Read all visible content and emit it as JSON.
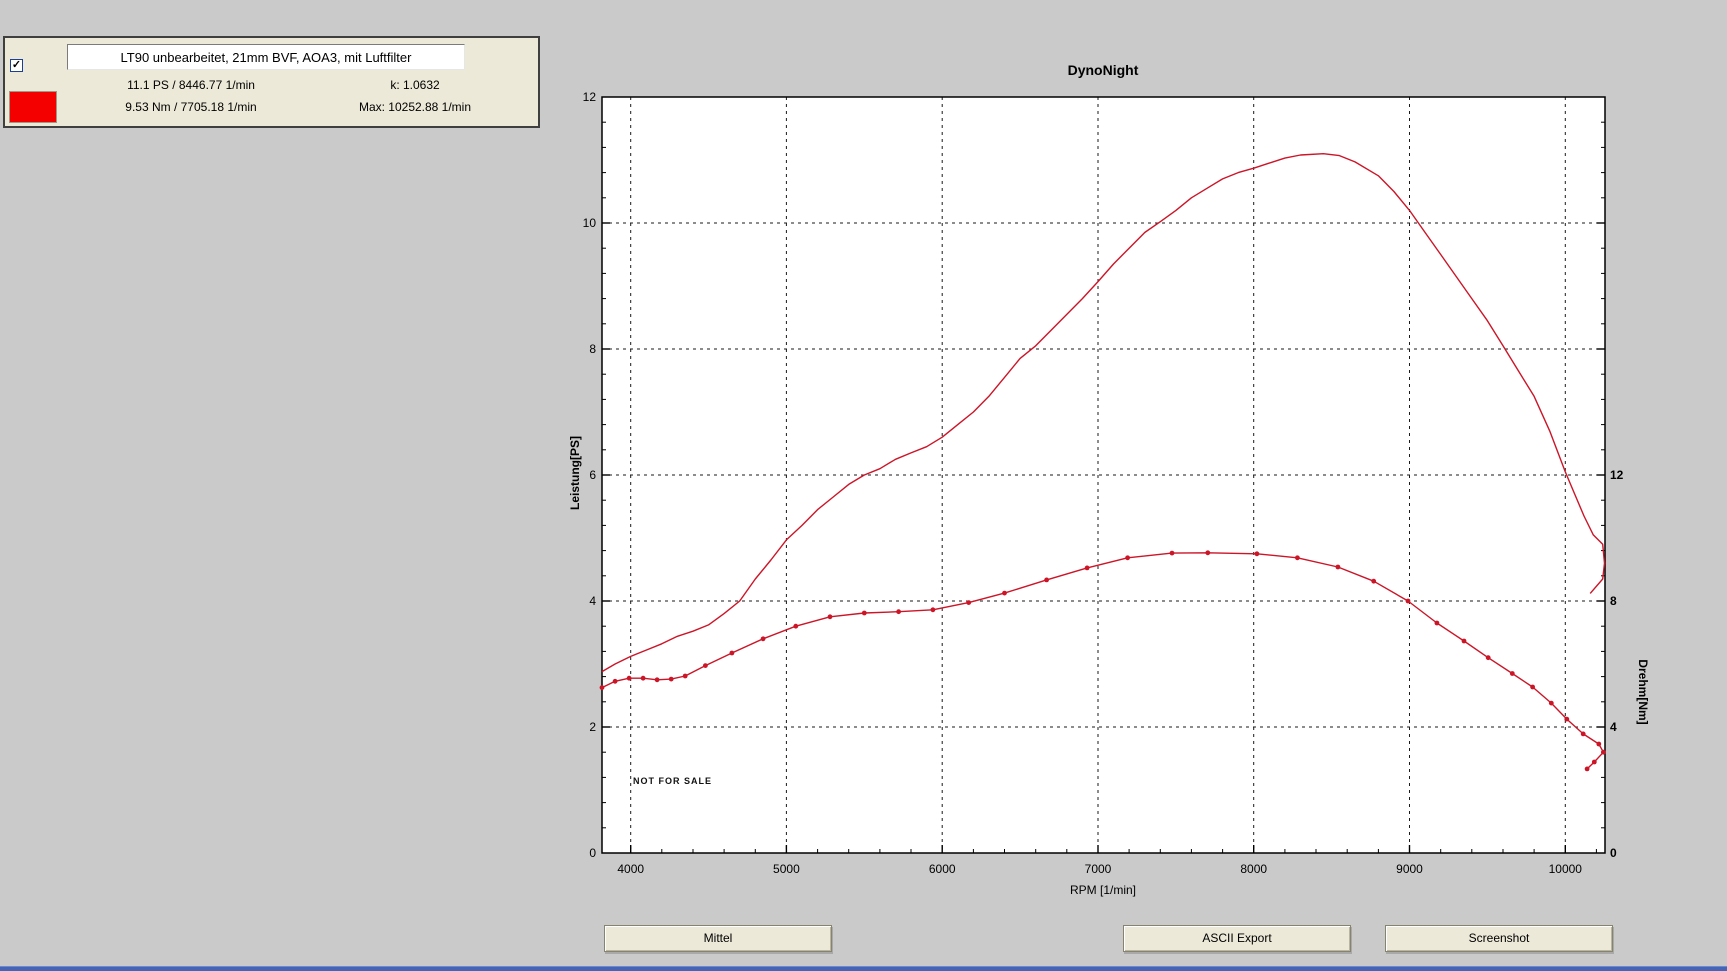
{
  "colors": {
    "background": "#cacaca",
    "panel_face": "#ece9d8",
    "plot_background": "#ffffff",
    "curve_red": "#cc1527",
    "swatch_red": "#f50000",
    "grid_black": "#1a1a1a",
    "bottom_strip_blue": "#4465b6"
  },
  "icons": {
    "checkbox_check": "✓"
  },
  "info_panel": {
    "checkbox_checked": true,
    "run_title": "LT90 unbearbeitet, 21mm BVF, AOA3, mit Luftfilter",
    "stats": {
      "power_peak": "11.1 PS / 8446.77 1/min",
      "k_factor": "k: 1.0632",
      "torque_peak": "9.53 Nm / 7705.18 1/min",
      "max_rpm": "Max: 10252.88 1/min"
    }
  },
  "buttons": [
    {
      "label": "Mittel"
    },
    {
      "label": "ASCII Export"
    },
    {
      "label": "Screenshot"
    }
  ],
  "chart_data": {
    "type": "line",
    "title": "DynoNight",
    "xlabel": "RPM [1/min]",
    "ylabel_left": "Leistung[PS]",
    "ylabel_right": "Drehm[Nm]",
    "watermark": "NOT FOR SALE",
    "grid": "dashed",
    "x_range": [
      3816,
      10255
    ],
    "x_major_ticks": [
      4000,
      5000,
      6000,
      7000,
      8000,
      9000,
      10000
    ],
    "x_minor_step": 200,
    "ylim_left": [
      0,
      12
    ],
    "left_major_step": 2,
    "left_minor_step": 0.4,
    "ylim_right": [
      0,
      24
    ],
    "right_tick_labels": [
      12,
      8,
      4,
      0
    ],
    "series": [
      {
        "id": "power",
        "name": "Leistung [PS]",
        "axis": "left",
        "color": "#cc1527",
        "markers": false,
        "points": [
          [
            3816,
            2.88
          ],
          [
            3900,
            3.0
          ],
          [
            4000,
            3.12
          ],
          [
            4100,
            3.22
          ],
          [
            4200,
            3.32
          ],
          [
            4300,
            3.44
          ],
          [
            4400,
            3.52
          ],
          [
            4500,
            3.62
          ],
          [
            4600,
            3.8
          ],
          [
            4700,
            4.0
          ],
          [
            4800,
            4.35
          ],
          [
            4900,
            4.65
          ],
          [
            5000,
            4.97
          ],
          [
            5100,
            5.2
          ],
          [
            5200,
            5.45
          ],
          [
            5300,
            5.65
          ],
          [
            5400,
            5.85
          ],
          [
            5500,
            6.0
          ],
          [
            5600,
            6.1
          ],
          [
            5700,
            6.25
          ],
          [
            5800,
            6.35
          ],
          [
            5900,
            6.45
          ],
          [
            6000,
            6.6
          ],
          [
            6100,
            6.8
          ],
          [
            6200,
            7.0
          ],
          [
            6300,
            7.25
          ],
          [
            6400,
            7.55
          ],
          [
            6500,
            7.85
          ],
          [
            6600,
            8.05
          ],
          [
            6700,
            8.3
          ],
          [
            6800,
            8.55
          ],
          [
            6900,
            8.8
          ],
          [
            7000,
            9.07
          ],
          [
            7100,
            9.35
          ],
          [
            7200,
            9.6
          ],
          [
            7300,
            9.85
          ],
          [
            7400,
            10.02
          ],
          [
            7500,
            10.2
          ],
          [
            7600,
            10.4
          ],
          [
            7700,
            10.55
          ],
          [
            7800,
            10.7
          ],
          [
            7900,
            10.8
          ],
          [
            8000,
            10.87
          ],
          [
            8100,
            10.95
          ],
          [
            8200,
            11.03
          ],
          [
            8300,
            11.08
          ],
          [
            8447,
            11.1
          ],
          [
            8550,
            11.07
          ],
          [
            8650,
            10.97
          ],
          [
            8800,
            10.75
          ],
          [
            8900,
            10.5
          ],
          [
            9000,
            10.2
          ],
          [
            9100,
            9.85
          ],
          [
            9200,
            9.5
          ],
          [
            9300,
            9.15
          ],
          [
            9400,
            8.8
          ],
          [
            9500,
            8.45
          ],
          [
            9600,
            8.05
          ],
          [
            9700,
            7.65
          ],
          [
            9800,
            7.25
          ],
          [
            9900,
            6.7
          ],
          [
            10000,
            6.05
          ],
          [
            10060,
            5.7
          ],
          [
            10120,
            5.35
          ],
          [
            10180,
            5.05
          ],
          [
            10240,
            4.9
          ],
          [
            10252,
            4.6
          ],
          [
            10240,
            4.35
          ],
          [
            10160,
            4.12
          ]
        ]
      },
      {
        "id": "torque",
        "name": "Drehmoment [Nm]",
        "axis": "right",
        "color": "#cc1527",
        "markers": true,
        "points": [
          [
            3816,
            5.25
          ],
          [
            3900,
            5.45
          ],
          [
            3990,
            5.55
          ],
          [
            4080,
            5.55
          ],
          [
            4170,
            5.5
          ],
          [
            4260,
            5.52
          ],
          [
            4350,
            5.62
          ],
          [
            4480,
            5.95
          ],
          [
            4650,
            6.35
          ],
          [
            4850,
            6.8
          ],
          [
            5060,
            7.2
          ],
          [
            5280,
            7.5
          ],
          [
            5500,
            7.62
          ],
          [
            5720,
            7.66
          ],
          [
            5940,
            7.72
          ],
          [
            6170,
            7.95
          ],
          [
            6400,
            8.25
          ],
          [
            6670,
            8.67
          ],
          [
            6930,
            9.05
          ],
          [
            7190,
            9.37
          ],
          [
            7475,
            9.52
          ],
          [
            7705,
            9.53
          ],
          [
            8020,
            9.5
          ],
          [
            8280,
            9.37
          ],
          [
            8540,
            9.08
          ],
          [
            8770,
            8.63
          ],
          [
            8990,
            8.0
          ],
          [
            9176,
            7.3
          ],
          [
            9350,
            6.73
          ],
          [
            9505,
            6.2
          ],
          [
            9660,
            5.7
          ],
          [
            9790,
            5.27
          ],
          [
            9910,
            4.76
          ],
          [
            10010,
            4.25
          ],
          [
            10115,
            3.78
          ],
          [
            10215,
            3.46
          ],
          [
            10245,
            3.2
          ],
          [
            10186,
            2.89
          ],
          [
            10140,
            2.67
          ]
        ]
      }
    ]
  }
}
